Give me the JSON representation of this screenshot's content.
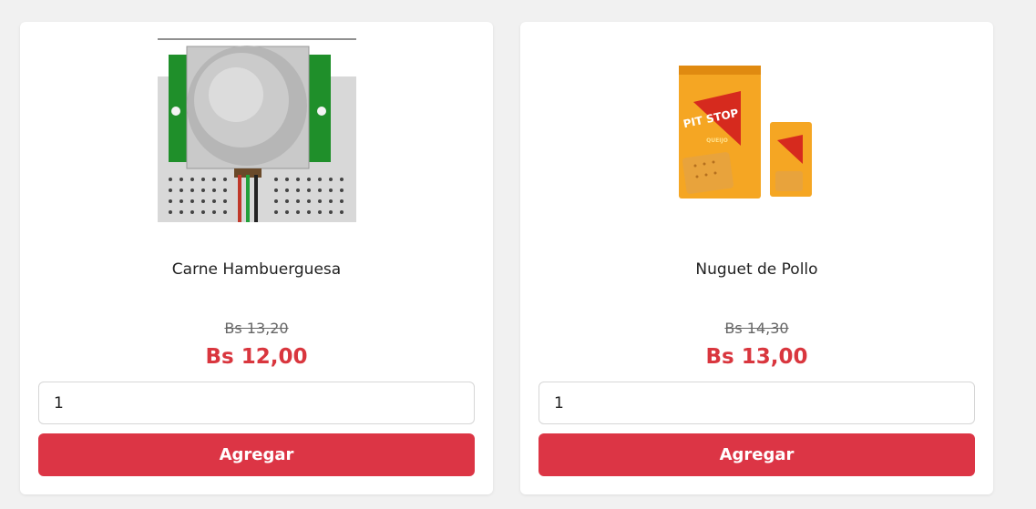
{
  "colors": {
    "accent": "#dc3545",
    "price": "#d9363e",
    "background": "#f1f1f1",
    "card": "#ffffff"
  },
  "products": [
    {
      "name": "Carne Hambuerguesa",
      "old_price": "Bs 13,20",
      "price": "Bs 12,00",
      "quantity": "1",
      "button_label": "Agregar",
      "image": "pir-motion-sensor-image"
    },
    {
      "name": "Nuguet de Pollo",
      "old_price": "Bs 14,30",
      "price": "Bs 13,00",
      "quantity": "1",
      "button_label": "Agregar",
      "image": "pit-stop-crackers-image",
      "image_text": {
        "brand": "PIT STOP",
        "flavor": "QUEIJO"
      }
    }
  ]
}
